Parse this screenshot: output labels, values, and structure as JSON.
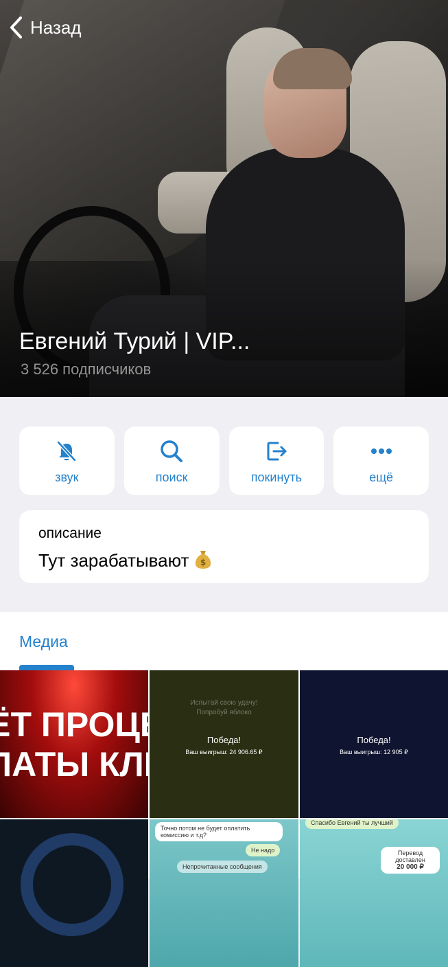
{
  "header": {
    "back_label": "Назад",
    "channel_title": "Евгений Турий | VIP...",
    "subscribers": "3 526 подписчиков"
  },
  "actions": [
    {
      "label": "звук",
      "icon": "bell-slash-icon"
    },
    {
      "label": "поиск",
      "icon": "search-icon"
    },
    {
      "label": "покинуть",
      "icon": "leave-icon"
    },
    {
      "label": "ещё",
      "icon": "more-dots-icon"
    }
  ],
  "description": {
    "label": "описание",
    "text": "Тут зарабатывают"
  },
  "media": {
    "tab_label": "Медиа",
    "thumbs": {
      "t1_line1": "ЁТ ПРОЦЕ",
      "t1_line2": "ЛАТЫ КЛИ",
      "t2_top": "Испытай свою удачу!",
      "t2_sub": "Попробуй яблоко",
      "t2_win": "Победа!",
      "t2_sum": "Ваш выигрыш: 24 906.65 ₽",
      "t3_win": "Победа!",
      "t3_sum": "Ваш выигрыш: 12 905 ₽",
      "t5_msg": "Точно потом не будет оплатить комиссию и т.д?",
      "t5_reply": "Не надо",
      "t5_unread": "Непрочитанные сообщения",
      "t6_msg": "Спасибо Евгений ты лучший",
      "t6_transfer": "Перевод доставлен",
      "t6_amount": "20 000 ₽"
    }
  },
  "colors": {
    "accent": "#2481cc",
    "background": "#efeff4"
  }
}
